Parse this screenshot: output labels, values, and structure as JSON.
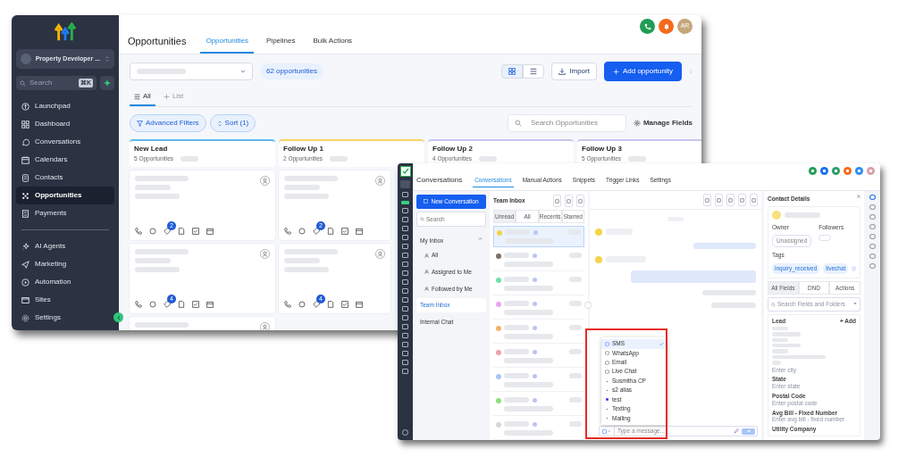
{
  "opportunities_window": {
    "sidebar": {
      "account": "Property Developer ...",
      "search_placeholder": "Search",
      "shortcut": "⌘K",
      "items": [
        {
          "label": "Launchpad",
          "selected": false
        },
        {
          "label": "Dashboard",
          "selected": false
        },
        {
          "label": "Conversations",
          "selected": false
        },
        {
          "label": "Calendars",
          "selected": false
        },
        {
          "label": "Contacts",
          "selected": false
        },
        {
          "label": "Opportunities",
          "selected": true
        },
        {
          "label": "Payments",
          "selected": false
        }
      ],
      "items_2": [
        {
          "label": "AI Agents",
          "selected": false
        },
        {
          "label": "Marketing",
          "selected": false
        },
        {
          "label": "Automation",
          "selected": false
        },
        {
          "label": "Sites",
          "selected": false
        }
      ],
      "settings": "Settings"
    },
    "avatar": "AR",
    "title": "Opportunities",
    "tabs": [
      {
        "label": "Opportunities",
        "selected": true
      },
      {
        "label": "Pipelines",
        "selected": false
      },
      {
        "label": "Bulk Actions",
        "selected": false
      }
    ],
    "count": "62 opportunities",
    "import": "Import",
    "add": "Add opportunity",
    "views": [
      {
        "label": "All",
        "selected": true
      },
      {
        "label": "List",
        "selected": false
      }
    ],
    "filters": [
      "Advanced Filters",
      "Sort (1)"
    ],
    "search_placeholder": "Search Opportunities",
    "manage_fields": "Manage Fields",
    "stages": [
      {
        "name": "New Lead",
        "count": "5 Opportunities",
        "color": "#5bb8f0",
        "cards": [
          {
            "kind": "opportunity",
            "badge": "2"
          },
          {
            "kind": "opportunity",
            "badge": "4"
          },
          {
            "kind": "opportunity"
          }
        ]
      },
      {
        "name": "Follow Up 1",
        "count": "2 Opportunities",
        "color": "#f5d36b",
        "cards": [
          {
            "kind": "opportunity",
            "badge": "2"
          },
          {
            "kind": "opportunity",
            "badge": "4"
          }
        ]
      },
      {
        "name": "Follow Up 2",
        "count": "4 Opportunities",
        "color": "#c9c6ee"
      },
      {
        "name": "Follow Up 3",
        "count": "5 Opportunities",
        "color": "#c9c6ee"
      }
    ]
  },
  "conversations_window": {
    "title": "Conversations",
    "tabs": [
      {
        "label": "Conversations",
        "selected": true
      },
      {
        "label": "Manual Actions",
        "selected": false
      },
      {
        "label": "Snippets",
        "selected": false
      },
      {
        "label": "Trigger Links",
        "selected": false
      },
      {
        "label": "Settings",
        "selected": false
      }
    ],
    "new_conversation": "New Conversation",
    "search_placeholder": "Search",
    "inbox_heading": "My Inbox",
    "inbox_items": [
      {
        "label": "All",
        "selected": false
      },
      {
        "label": "Assigned to Me",
        "selected": false
      },
      {
        "label": "Followed by Me",
        "selected": false
      }
    ],
    "other_items": [
      {
        "label": "Team Inbox",
        "selected": true
      },
      {
        "label": "Internal Chat",
        "selected": false
      }
    ],
    "list_title": "Team Inbox",
    "list_tabs": [
      {
        "label": "Unread",
        "selected": true
      },
      {
        "label": "All",
        "selected": false
      },
      {
        "label": "Recents",
        "selected": false
      },
      {
        "label": "Starred",
        "selected": false
      }
    ],
    "conversations": [
      {
        "color": "#f5d44a",
        "selected": true
      },
      {
        "color": "#7a7068",
        "selected": false
      },
      {
        "color": "#6ee0a8",
        "selected": false
      },
      {
        "color": "#e7a6ee",
        "selected": false
      },
      {
        "color": "#f5b36b",
        "selected": false
      },
      {
        "color": "#f2a0a8",
        "selected": false
      },
      {
        "color": "#a9c4f5",
        "selected": false
      },
      {
        "color": "#8fe07a",
        "selected": false
      },
      {
        "color": "#d8d8d8",
        "selected": false
      }
    ],
    "channels": [
      {
        "label": "SMS",
        "selected": true
      },
      {
        "label": "WhatsApp",
        "selected": false
      },
      {
        "label": "Email",
        "selected": false
      },
      {
        "label": "Live Chat",
        "selected": false
      },
      {
        "label": "Susmitha CP",
        "selected": false
      },
      {
        "label": "s2 alias",
        "selected": false
      },
      {
        "label": "test",
        "selected": false
      },
      {
        "label": "Texting",
        "selected": false
      },
      {
        "label": "Mailing",
        "selected": false
      }
    ],
    "message_placeholder": "Type a message...",
    "contact": {
      "title": "Contact Details",
      "owner_label": "Owner",
      "owner": "Unassigned",
      "followers_label": "Followers",
      "tags_label": "Tags",
      "tags": [
        "inquiry_received",
        "livechat"
      ],
      "tabs": [
        {
          "label": "All Fields",
          "selected": true
        },
        {
          "label": "DND",
          "selected": false
        },
        {
          "label": "Actions",
          "selected": false
        }
      ],
      "search_placeholder": "Search Fields and Folders",
      "section": "Lead",
      "add": "+ Add",
      "fields": [
        {
          "label": "State",
          "placeholder": "Enter state"
        },
        {
          "label": "Postal Code",
          "placeholder": "Enter postal code"
        },
        {
          "label": "Avg Bill - Fixed Number",
          "placeholder": "Enter avg bill - fixed number"
        },
        {
          "label": "Utility Company"
        }
      ],
      "city_placeholder": "Enter city"
    }
  }
}
